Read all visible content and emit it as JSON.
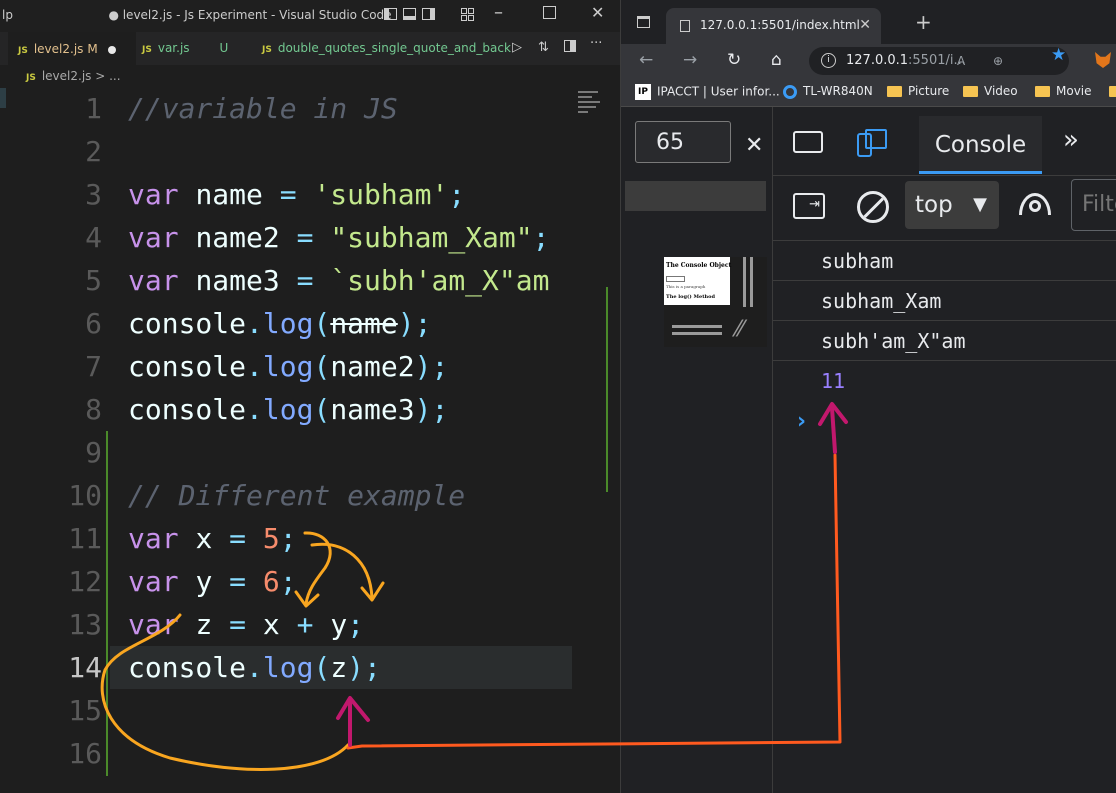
{
  "vscode": {
    "app_letter": "lp",
    "window_title": "● level2.js - Js Experiment - Visual Studio Code",
    "tabs": [
      {
        "badge": "JS",
        "name": "level2.js",
        "status": "M"
      },
      {
        "badge": "JS",
        "name": "var.js",
        "status": "U"
      },
      {
        "badge": "JS",
        "name": "double_quotes_single_quote_and_back"
      }
    ],
    "breadcrumb": {
      "badge": "JS",
      "file": "level2.js",
      "sep": "> ..."
    },
    "current_line": 14,
    "lines": [
      {
        "n": "1"
      },
      {
        "n": "2"
      },
      {
        "n": "3"
      },
      {
        "n": "4"
      },
      {
        "n": "5"
      },
      {
        "n": "6"
      },
      {
        "n": "7"
      },
      {
        "n": "8"
      },
      {
        "n": "9"
      },
      {
        "n": "10"
      },
      {
        "n": "11"
      },
      {
        "n": "12"
      },
      {
        "n": "13"
      },
      {
        "n": "14"
      },
      {
        "n": "15"
      },
      {
        "n": "16"
      }
    ],
    "code": {
      "l1": "//variable in JS",
      "l3": {
        "kw": "var",
        "id": "name",
        "op": "=",
        "val": "'subham'",
        "end": ";"
      },
      "l4": {
        "kw": "var",
        "id": "name2",
        "op": "=",
        "val": "\"subham_Xam\"",
        "end": ";"
      },
      "l5": {
        "kw": "var",
        "id": "name3",
        "op": "=",
        "val": "`subh'am_X\"am"
      },
      "l6": {
        "obj": "console",
        "fn": "log",
        "arg": "name",
        "end": ");"
      },
      "l7": {
        "obj": "console",
        "fn": "log",
        "arg": "name2",
        "end": ");"
      },
      "l8": {
        "obj": "console",
        "fn": "log",
        "arg": "name3",
        "end": ");"
      },
      "l10": "// Different example",
      "l11": {
        "kw": "var",
        "id": "x",
        "op": "=",
        "val": "5",
        "end": ";"
      },
      "l12": {
        "kw": "var",
        "id": "y",
        "op": "=",
        "val": "6",
        "end": ";"
      },
      "l13": {
        "kw": "var",
        "id": "z",
        "op": "=",
        "a": "x",
        "plus": "+",
        "b": "y",
        "end": ";"
      },
      "l14": {
        "obj": "console",
        "fn": "log",
        "arg": "z",
        "end": ");"
      }
    }
  },
  "browser": {
    "tab_title": "127.0.0.1:5501/index.html",
    "url_host": "127.0.0.1",
    "url_rest": ":5501/i...",
    "bookmarks": [
      {
        "label": "IPACCT | User infor...",
        "icon": "ip-logo-icon"
      },
      {
        "label": "TL-WR840N",
        "icon": "router-icon"
      },
      {
        "label": "Picture",
        "icon": "folder-icon"
      },
      {
        "label": "Video",
        "icon": "folder-icon"
      },
      {
        "label": "Movie",
        "icon": "folder-icon"
      }
    ],
    "devtools": {
      "zoom_value": "65",
      "active_tab": "Console",
      "context": "top",
      "filter_placeholder": "Filter",
      "thumbnail": {
        "title": "The Console Object",
        "para": "This is a paragraph",
        "method": "The log() Method"
      },
      "console_logs": [
        "subham",
        "subham_Xam",
        "subh'am_X\"am",
        "11"
      ],
      "prompt": "›"
    }
  },
  "colors": {
    "annotation_orange": "#f9a620",
    "annotation_magenta": "#c2186d",
    "annotation_red_orange": "#ff5a1f",
    "accent_blue": "#3b9bf4"
  }
}
